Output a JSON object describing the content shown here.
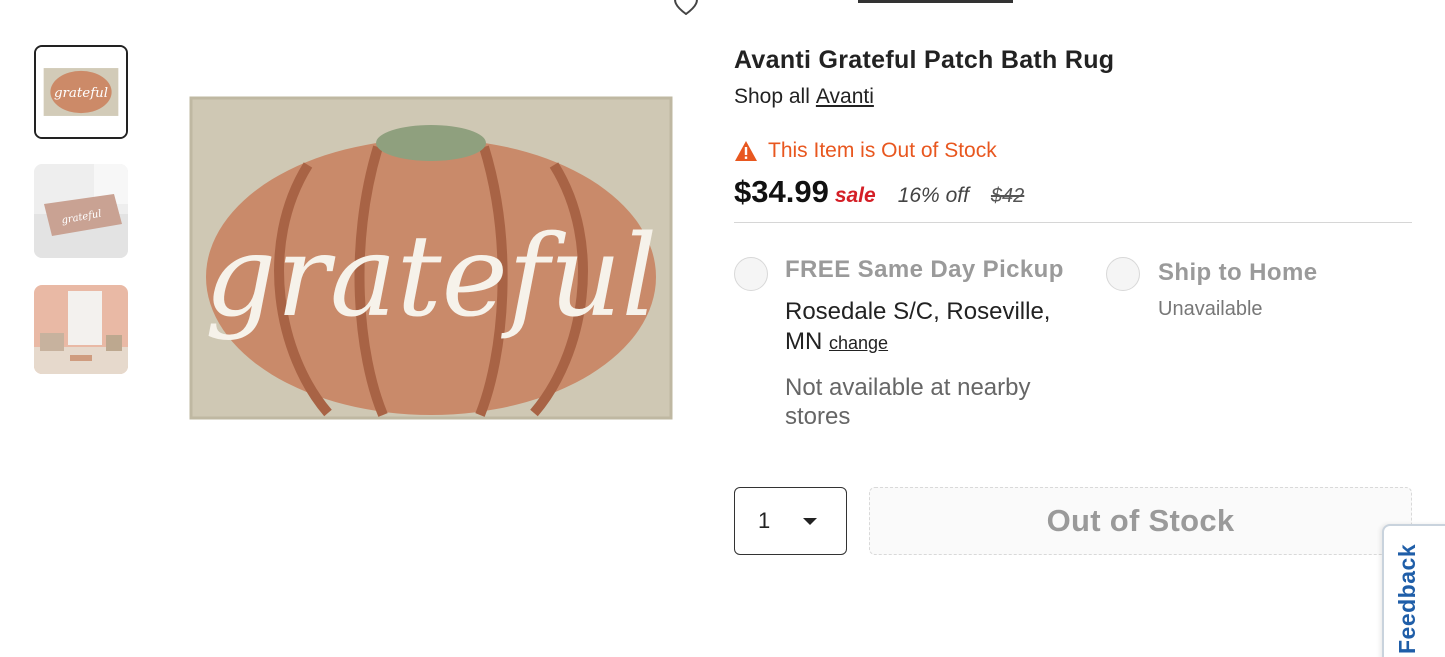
{
  "product": {
    "title": "Avanti Grateful Patch Bath Rug",
    "shop_all_prefix": "Shop all",
    "brand_link": "Avanti",
    "stock_alert": "This Item is Out of Stock",
    "price": "$34.99",
    "sale_label": "sale",
    "discount": "16% off",
    "original_price": "$42",
    "rug_text": "grateful"
  },
  "fulfillment": {
    "pickup": {
      "title": "FREE Same Day Pickup",
      "store": "Rosedale S/C, Roseville, MN",
      "change_link": "change",
      "availability": "Not available at nearby stores"
    },
    "ship": {
      "title": "Ship to Home",
      "status": "Unavailable"
    }
  },
  "purchase": {
    "quantity": "1",
    "button_label": "Out of Stock"
  },
  "feedback_tab": {
    "label": "Feedback"
  },
  "colors": {
    "alert_orange": "#e8571f",
    "sale_red": "#d41f26",
    "feedback_blue": "#1f5ea8",
    "pumpkin": "#c98a6a",
    "rug_base": "#cfc8b4"
  }
}
